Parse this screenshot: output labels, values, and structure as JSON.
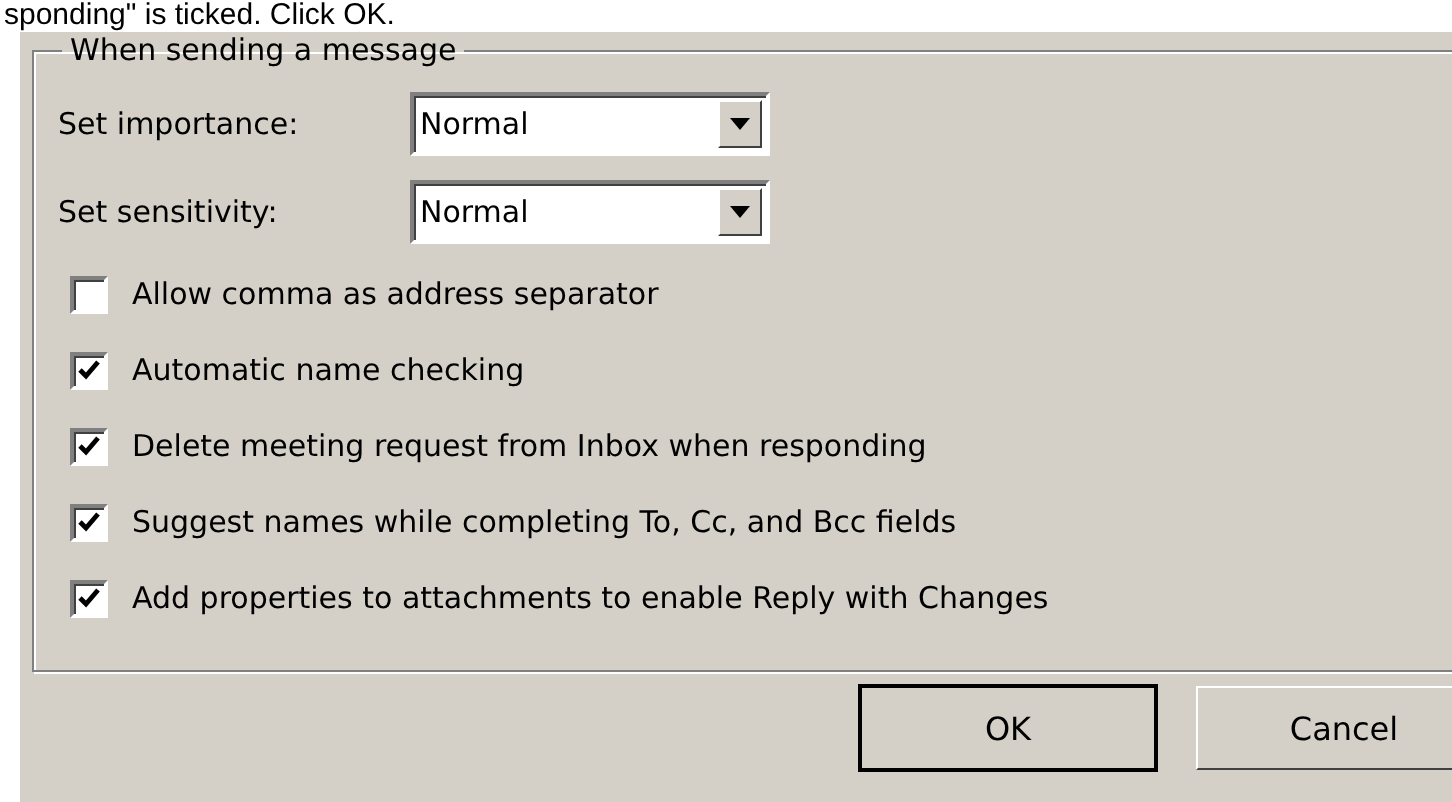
{
  "caption": "sponding\" is ticked. Click OK.",
  "group": {
    "title": "When sending a message"
  },
  "dropdowns": [
    {
      "label": "Set importance:",
      "value": "Normal"
    },
    {
      "label": "Set sensitivity:",
      "value": "Normal"
    }
  ],
  "options": [
    {
      "label": "Allow comma as address separator",
      "checked": false
    },
    {
      "label": "Automatic name checking",
      "checked": true
    },
    {
      "label": "Delete meeting request from Inbox when responding",
      "checked": true
    },
    {
      "label": "Suggest names while completing To, Cc, and Bcc fields",
      "checked": true
    },
    {
      "label": "Add properties to attachments to enable Reply with Changes",
      "checked": true
    }
  ],
  "buttons": [
    {
      "label": "OK",
      "kind": "default"
    },
    {
      "label": "Cancel",
      "kind": "normal"
    }
  ]
}
